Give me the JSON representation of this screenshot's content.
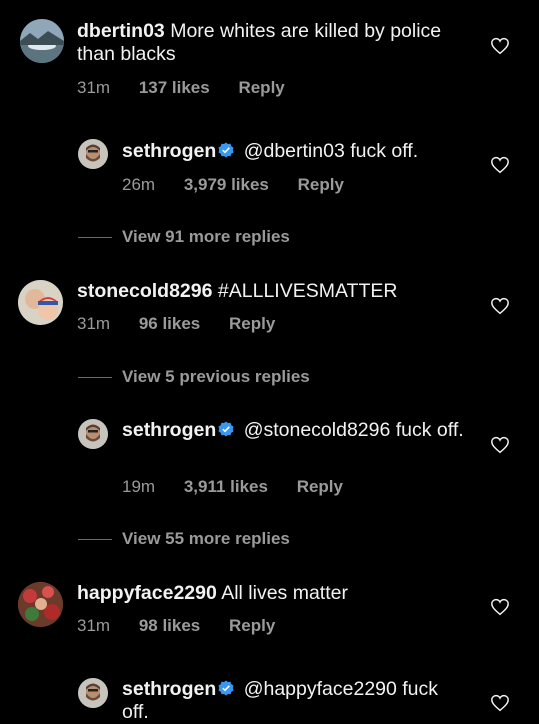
{
  "comments": [
    {
      "username": "dbertin03",
      "text": "More whites are killed by police than blacks",
      "time": "31m",
      "likes": "137 likes",
      "reply": "Reply"
    },
    {
      "username": "sethrogen",
      "text": "@dbertin03 fuck off.",
      "time": "26m",
      "likes": "3,979 likes",
      "reply": "Reply"
    },
    {
      "username": "stonecold8296",
      "text": "#ALLLIVESMATTER",
      "time": "31m",
      "likes": "96 likes",
      "reply": "Reply"
    },
    {
      "username": "sethrogen",
      "text": "@stonecold8296 fuck off.",
      "time": "19m",
      "likes": "3,911 likes",
      "reply": "Reply"
    },
    {
      "username": "happyface2290",
      "text": "All lives matter",
      "time": "31m",
      "likes": "98 likes",
      "reply": "Reply"
    },
    {
      "username": "sethrogen",
      "text": "@happyface2290 fuck off."
    }
  ],
  "view_replies": [
    "View 91 more replies",
    "View 5 previous replies",
    "View 55 more replies"
  ],
  "colors": {
    "background": "#000000",
    "text": "#f2f2f2",
    "meta": "#9a9a9a",
    "verified": "#3897f0"
  },
  "icons": {
    "like": "heart-outline-icon",
    "verified": "verified-badge-icon"
  }
}
